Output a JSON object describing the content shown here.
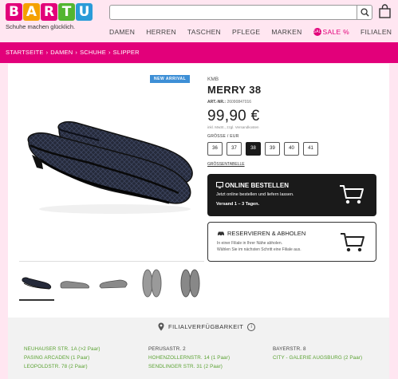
{
  "header": {
    "logo_letters": [
      "B",
      "A",
      "R",
      "T",
      "U"
    ],
    "logo_colors": [
      "#e2007a",
      "#f5a000",
      "#e2007a",
      "#53b530",
      "#2a9bd8"
    ],
    "tagline": "Schuhe machen glücklich.",
    "search": {
      "value": "",
      "placeholder": ""
    },
    "nav": [
      "DAMEN",
      "HERREN",
      "TASCHEN",
      "PFLEGE",
      "MARKEN",
      "SALE %",
      "FILIALEN"
    ],
    "sale_badge": "SALE"
  },
  "breadcrumb": [
    "STARTSEITE",
    "DAMEN",
    "SCHUHE",
    "SLIPPER"
  ],
  "breadcrumb_separator": "›",
  "product": {
    "badge": "NEW ARRIVAL",
    "brand": "KMB",
    "name": "MERRY 38",
    "art_label": "ART.-NR.:",
    "art_nr": "26090847016",
    "price": "99,90 €",
    "price_note": "inkl. MwSt., zzgl. Versandkosten",
    "size_label": "GRÖSSE / EUR",
    "sizes": [
      "36",
      "37",
      "38",
      "39",
      "40",
      "41"
    ],
    "selected_size": "38",
    "size_table": "GRÖSSENTABELLE"
  },
  "online_order": {
    "title": "ONLINE BESTELLEN",
    "desc": "Jetzt online bestellen und liefern lassen.",
    "delivery": "Versand 1 – 3 Tagen."
  },
  "pickup": {
    "title": "RESERVIEREN & ABHOLEN",
    "desc_line1": "In einer Filiale in Ihrer Nähe abholen.",
    "desc_line2": "Wählen Sie im nächsten Schritt eine Filiale aus."
  },
  "availability": {
    "heading": "FILIALVERFÜGBARKEIT",
    "stores": [
      {
        "name": "NEUHAUSER STR. 1A (>2 Paar)",
        "status": "available"
      },
      {
        "name": "PERUSASTR. 2",
        "status": "none"
      },
      {
        "name": "BAYERSTR. 8",
        "status": "none"
      },
      {
        "name": "PASING ARCADEN (1 Paar)",
        "status": "available"
      },
      {
        "name": "HOHENZOLLERNSTR. 14 (1 Paar)",
        "status": "available"
      },
      {
        "name": "CITY - GALERIE AUGSBURG (2 Paar)",
        "status": "available"
      },
      {
        "name": "LEOPOLDSTR. 78 (2 Paar)",
        "status": "available"
      },
      {
        "name": "SENDLINGER STR. 31 (2 Paar)",
        "status": "available"
      }
    ]
  },
  "colors": {
    "brand_pink": "#e2007a",
    "available_green": "#5aa232",
    "dark": "#1a1a1a"
  }
}
